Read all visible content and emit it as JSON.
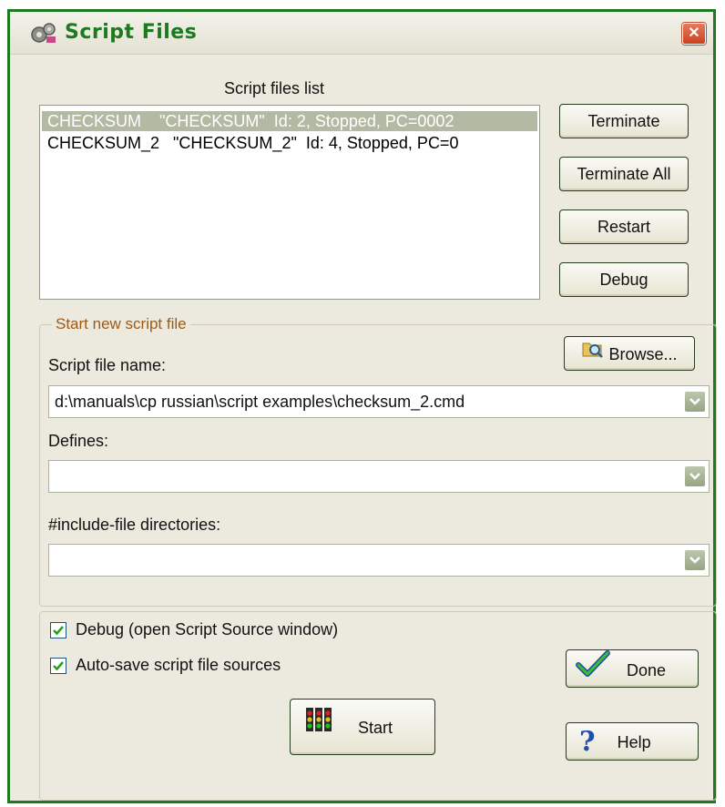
{
  "window": {
    "title": "Script Files",
    "close_glyph": "✕"
  },
  "list": {
    "label": "Script files list",
    "rows": [
      {
        "text": "CHECKSUM    \"CHECKSUM\"  Id: 2, Stopped, PC=0002",
        "selected": true
      },
      {
        "text": "CHECKSUM_2   \"CHECKSUM_2\"  Id: 4, Stopped, PC=0",
        "selected": false
      }
    ]
  },
  "buttons": {
    "terminate": "Terminate",
    "terminate_all": "Terminate All",
    "restart": "Restart",
    "debug": "Debug",
    "browse": "Browse...",
    "done": "Done",
    "help": "Help",
    "start": "Start"
  },
  "new_script": {
    "group_title": "Start new script file",
    "name_label": "Script file name:",
    "name_value": "d:\\manuals\\cp russian\\script examples\\checksum_2.cmd",
    "defines_label": "Defines:",
    "defines_value": "",
    "include_label": "#include-file directories:",
    "include_value": ""
  },
  "options": {
    "debug_label": "Debug (open Script Source window)",
    "debug_checked": true,
    "autosave_label": "Auto-save script file sources",
    "autosave_checked": true
  },
  "icons": {
    "title": "gears-icon",
    "browse": "folder-search-icon",
    "done": "checkmark-icon",
    "help": "question-mark-icon",
    "start": "traffic-lights-icon"
  },
  "colors": {
    "title_text": "#1d7a20",
    "window_border": "#1e7a1e",
    "selection": "#b3b9a2",
    "group_title": "#9a5a1a"
  }
}
